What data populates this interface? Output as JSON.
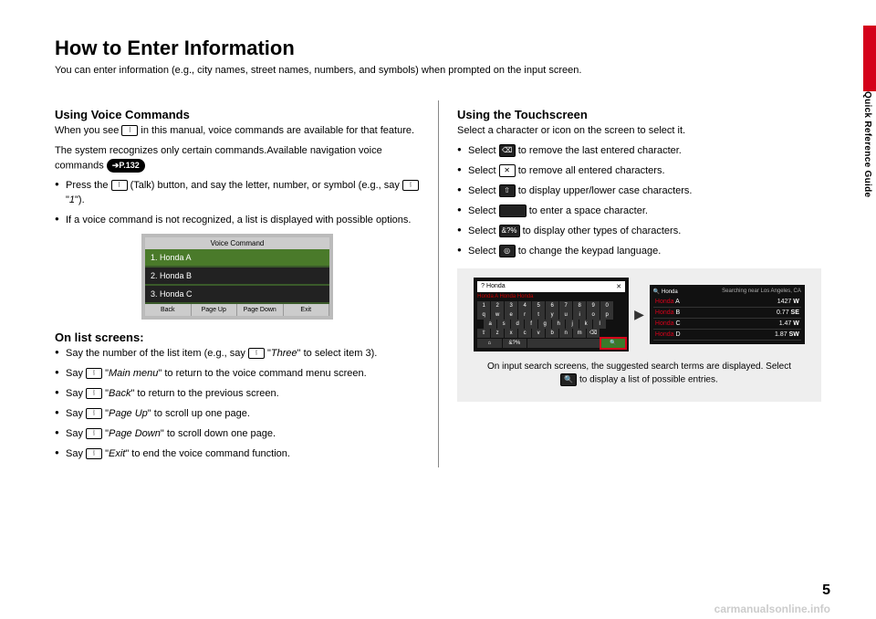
{
  "sideLabel": "Quick Reference Guide",
  "title": "How to Enter Information",
  "subtitle": "You can enter information (e.g., city names, street names, numbers, and symbols) when prompted on the input screen.",
  "pageNum": "5",
  "watermark": "carmanualsonline.info",
  "left": {
    "h1": "Using Voice Commands",
    "p1a": "When you see ",
    "p1b": " in this manual, voice commands are available for that feature.",
    "p2": "The system recognizes only certain commands.Available navigation voice commands ",
    "pillRef": "P.132",
    "b1a": "Press the ",
    "b1b": " (Talk) button, and say the letter, number, or symbol (e.g., say ",
    "b1c": " \"",
    "b1d": "1",
    "b1e": "\").",
    "b2": "If a voice command is not recognized, a list is displayed with possible options.",
    "vcTitle": "Voice Command",
    "vcRows": [
      "1. Honda A",
      "2. Honda B",
      "3. Honda C"
    ],
    "vcBottom": [
      "Back",
      "Page Up",
      "Page Down",
      "Exit"
    ],
    "h2": "On list screens:",
    "lb1a": "Say the number of the list item (e.g., say ",
    "lb1b": " \"",
    "lb1c": "Three",
    "lb1d": "\" to select item 3).",
    "lb2a": "Say ",
    "lb2b": " \"",
    "lb2c": "Main menu",
    "lb2d": "\" to return to the voice command menu screen.",
    "lb3a": "Say ",
    "lb3b": " \"",
    "lb3c": "Back",
    "lb3d": "\" to return to the previous screen.",
    "lb4a": "Say ",
    "lb4b": " \"",
    "lb4c": "Page Up",
    "lb4d": "\" to scroll up one page.",
    "lb5a": "Say ",
    "lb5b": " \"",
    "lb5c": "Page Down",
    "lb5d": "\" to scroll down one page.",
    "lb6a": "Say ",
    "lb6b": " \"",
    "lb6c": "Exit",
    "lb6d": "\" to end the voice command function."
  },
  "right": {
    "h1": "Using the Touchscreen",
    "p1": "Select a character or icon on the screen to select it.",
    "b1a": "Select ",
    "b1b": " to remove the last entered character.",
    "b2a": "Select ",
    "b2b": " to remove all entered characters.",
    "b3a": "Select ",
    "b3b": " to display upper/lower case characters.",
    "b4a": "Select ",
    "b4b": " to enter a space character.",
    "b5a": "Select ",
    "b5b": " to display other types of characters.",
    "b6a": "Select ",
    "b6b": " to change the keypad language.",
    "kbInput": "Honda",
    "kbX": "✕",
    "kbSuggest": "Honda A   Honda   Honda",
    "kbNums": [
      "1",
      "2",
      "3",
      "4",
      "5",
      "6",
      "7",
      "8",
      "9",
      "0"
    ],
    "kbRow1": [
      "q",
      "w",
      "e",
      "r",
      "t",
      "y",
      "u",
      "i",
      "o",
      "p"
    ],
    "kbRow2": [
      "a",
      "s",
      "d",
      "f",
      "g",
      "h",
      "j",
      "k",
      "l"
    ],
    "kbRow3": [
      "z",
      "x",
      "c",
      "v",
      "b",
      "n",
      "m"
    ],
    "kbBot": [
      "⌂",
      "&?%",
      " ",
      "🔍"
    ],
    "listHdr": "Searching near Los Angeles, CA",
    "listQ": "Honda",
    "listRows": [
      {
        "pre": "Honda",
        "suf": " A",
        "dist": "1427",
        "dir": "W"
      },
      {
        "pre": "Honda",
        "suf": " B",
        "dist": "0.77",
        "dir": "SE"
      },
      {
        "pre": "Honda",
        "suf": " C",
        "dist": "1.47",
        "dir": "W"
      },
      {
        "pre": "Honda",
        "suf": " D",
        "dist": "1.87",
        "dir": "SW"
      }
    ],
    "note1": "On input search screens, the suggested search terms are displayed. Select ",
    "note2": " to display a list of possible entries.",
    "iconLabels": {
      "backspace": "⌫",
      "clear": "✕",
      "shift": "⇧",
      "space": " ",
      "symbols": "&?%",
      "globe": "◎",
      "search": "🔍"
    }
  }
}
